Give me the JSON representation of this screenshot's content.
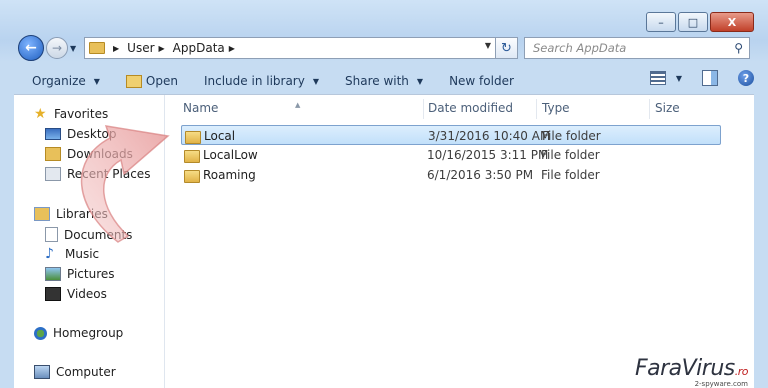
{
  "window": {
    "controls": [
      "–",
      "□",
      "X"
    ]
  },
  "address_bar": {
    "crumbs": [
      "User",
      "AppData"
    ],
    "refresh_glyph": "↻"
  },
  "search": {
    "placeholder": "Search AppData"
  },
  "toolbar": {
    "organize": "Organize",
    "open": "Open",
    "include_in_library": "Include in library",
    "share_with": "Share with",
    "new_folder": "New folder",
    "help": "?"
  },
  "nav": {
    "favorites": "Favorites",
    "desktop": "Desktop",
    "downloads": "Downloads",
    "recent_places": "Recent Places",
    "libraries": "Libraries",
    "documents": "Documents",
    "music": "Music",
    "pictures": "Pictures",
    "videos": "Videos",
    "homegroup": "Homegroup",
    "computer": "Computer"
  },
  "columns": {
    "name": "Name",
    "date_modified": "Date modified",
    "type": "Type",
    "size": "Size"
  },
  "files": [
    {
      "name": "Local",
      "date": "3/31/2016 10:40 AM",
      "type": "File folder",
      "selected": true
    },
    {
      "name": "LocalLow",
      "date": "10/16/2015 3:11 PM",
      "type": "File folder",
      "selected": false
    },
    {
      "name": "Roaming",
      "date": "6/1/2016 3:50 PM",
      "type": "File folder",
      "selected": false
    }
  ],
  "watermark": {
    "brand": "FaraVirus",
    "tld": ".ro",
    "sub": "2-spyware.com"
  },
  "colors": {
    "selection": "#cce4fb",
    "arrow": "#e8a0a0",
    "frame": "#c6dcf2"
  }
}
